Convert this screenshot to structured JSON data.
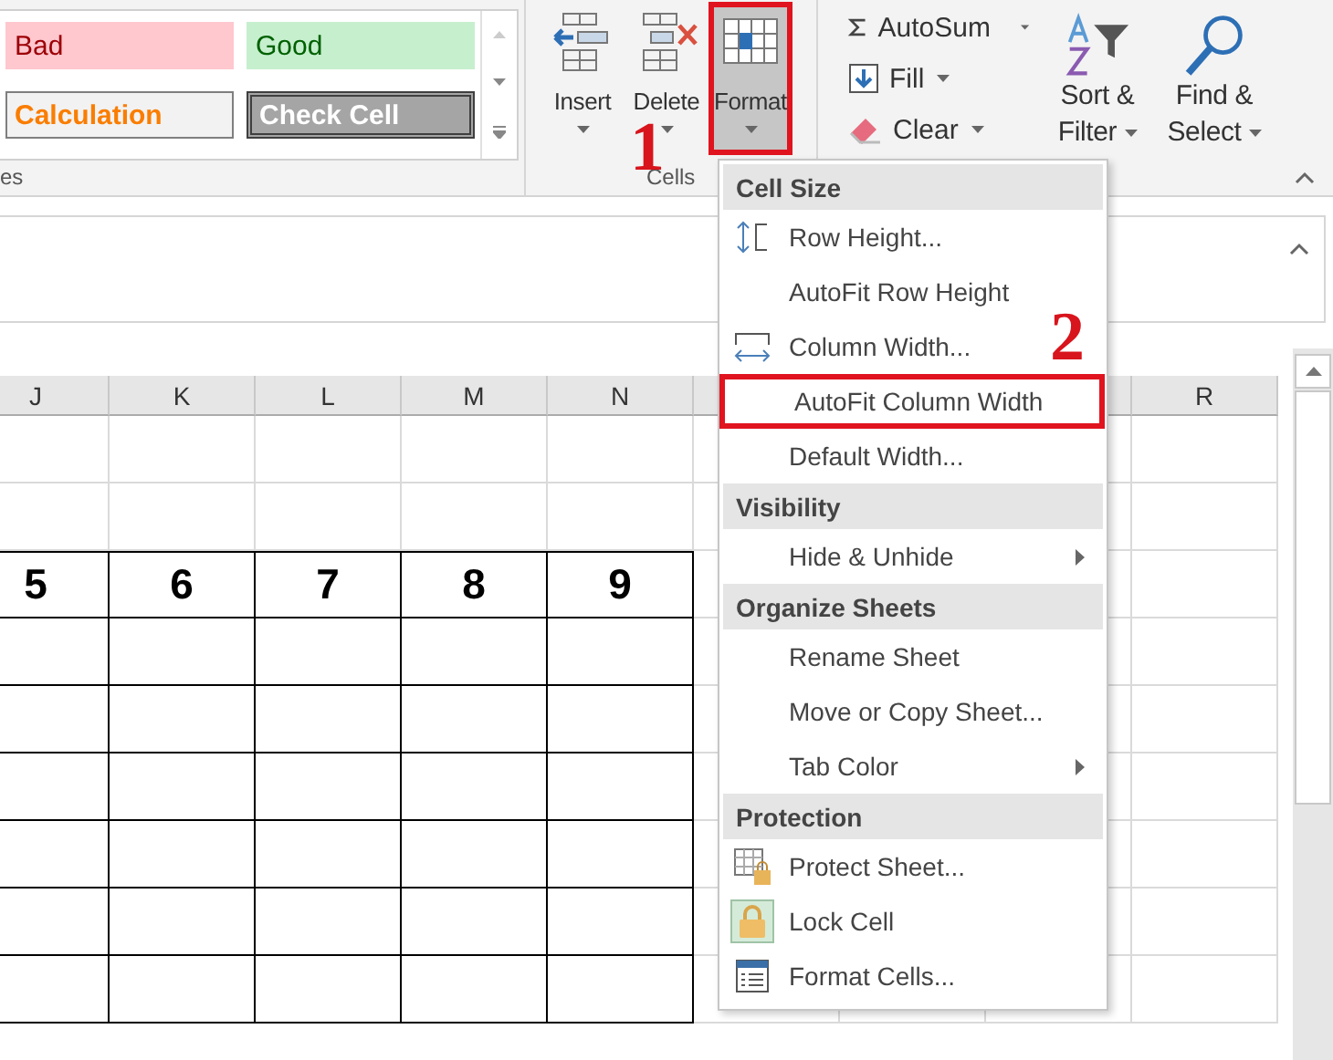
{
  "ribbon": {
    "styles_group": {
      "label": "es",
      "styles": [
        {
          "label": "Bad",
          "kind": "bad"
        },
        {
          "label": "Good",
          "kind": "good"
        },
        {
          "label": "Calculation",
          "kind": "calculation"
        },
        {
          "label": "Check Cell",
          "kind": "check"
        }
      ]
    },
    "cells_group": {
      "label": "Cells",
      "buttons": [
        {
          "label": "Insert",
          "annotated": false
        },
        {
          "label": "Delete",
          "annotated": false
        },
        {
          "label": "Format",
          "annotated": true
        }
      ]
    },
    "editing_group": {
      "small_buttons": [
        {
          "label": "AutoSum"
        },
        {
          "label": "Fill"
        },
        {
          "label": "Clear"
        }
      ],
      "big_buttons": [
        {
          "lines": [
            "Sort &",
            "Filter"
          ]
        },
        {
          "lines": [
            "Find &",
            "Select"
          ]
        }
      ]
    }
  },
  "sheet": {
    "columns": [
      "J",
      "K",
      "L",
      "M",
      "N"
    ],
    "right_columns": [
      "R"
    ],
    "rows": [
      {
        "cells": [
          "5",
          "6",
          "7",
          "8",
          "9"
        ]
      }
    ]
  },
  "format_menu": {
    "sections": [
      {
        "title": "Cell Size",
        "items": [
          {
            "label": "Row Height...",
            "checked": false,
            "submenu": false,
            "annotated": false
          },
          {
            "label": "AutoFit Row Height",
            "checked": false,
            "submenu": false,
            "annotated": false
          },
          {
            "label": "Column Width...",
            "checked": false,
            "submenu": false,
            "annotated": false
          },
          {
            "label": "AutoFit Column Width",
            "checked": false,
            "submenu": false,
            "annotated": true
          },
          {
            "label": "Default Width...",
            "checked": false,
            "submenu": false,
            "annotated": false
          }
        ]
      },
      {
        "title": "Visibility",
        "items": [
          {
            "label": "Hide & Unhide",
            "checked": false,
            "submenu": true,
            "annotated": false
          }
        ]
      },
      {
        "title": "Organize Sheets",
        "items": [
          {
            "label": "Rename Sheet",
            "checked": false,
            "submenu": false,
            "annotated": false
          },
          {
            "label": "Move or Copy Sheet...",
            "checked": false,
            "submenu": false,
            "annotated": false
          },
          {
            "label": "Tab Color",
            "checked": false,
            "submenu": true,
            "annotated": false
          }
        ]
      },
      {
        "title": "Protection",
        "items": [
          {
            "label": "Protect Sheet...",
            "checked": false,
            "submenu": false,
            "annotated": false
          },
          {
            "label": "Lock Cell",
            "checked": true,
            "submenu": false,
            "annotated": false
          },
          {
            "label": "Format Cells...",
            "checked": false,
            "submenu": false,
            "annotated": false
          }
        ]
      }
    ]
  },
  "annotations": [
    {
      "label": "1"
    },
    {
      "label": "2"
    }
  ]
}
